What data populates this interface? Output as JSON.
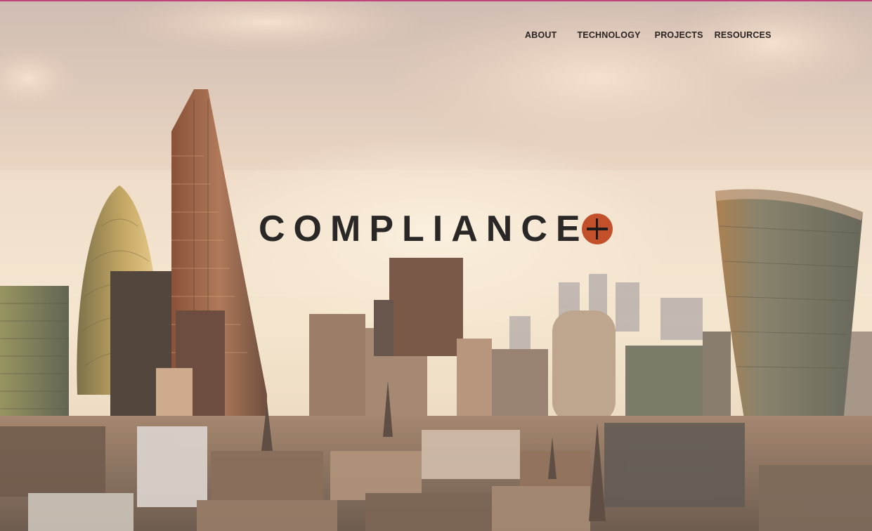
{
  "nav": {
    "items": [
      {
        "label": "ABOUT"
      },
      {
        "label": "TECHNOLOGY"
      },
      {
        "label": "PROJECTS"
      },
      {
        "label": "RESOURCES"
      }
    ]
  },
  "brand": {
    "name": "COMPLIANCE",
    "logo_icon": "plus-circle-icon",
    "accent_color": "#c2502a"
  },
  "hero": {
    "background": "city-skyline-image"
  }
}
